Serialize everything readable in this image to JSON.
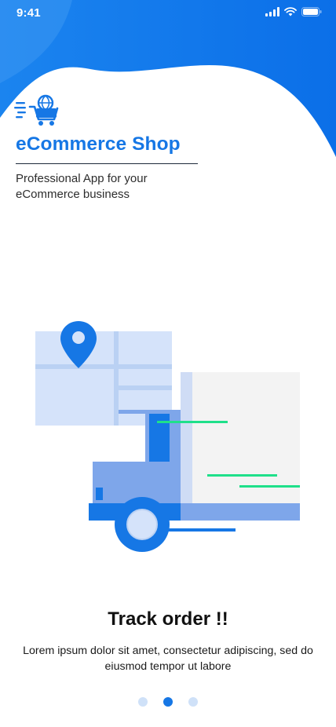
{
  "status_bar": {
    "time": "9:41",
    "icons": [
      "signal-icon",
      "wifi-icon",
      "battery-icon"
    ]
  },
  "brand": {
    "logo_icon": "shopping-cart-globe-icon",
    "title": "eCommerce Shop",
    "tagline": "Professional App for your eCommerce business"
  },
  "illustration": {
    "icons": [
      "map-pin-icon",
      "delivery-truck-icon"
    ]
  },
  "slide": {
    "title": "Track order !!",
    "description": "Lorem ipsum dolor sit amet, consectetur adipiscing, sed do eiusmod tempor ut labore"
  },
  "pager": {
    "count": 3,
    "active_index": 1
  },
  "colors": {
    "primary": "#1677e5",
    "primary_light": "#cfe1f8",
    "truck_mid": "#7ea6ea",
    "accent_green": "#1fe08a"
  }
}
